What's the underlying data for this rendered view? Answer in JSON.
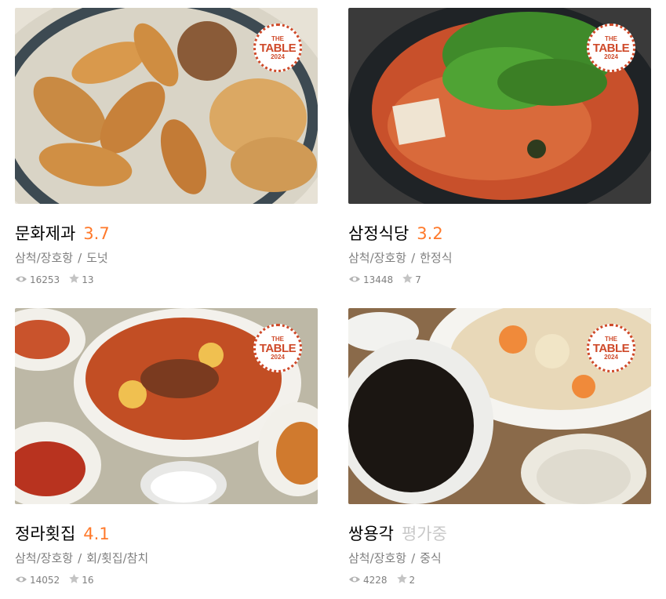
{
  "badge": {
    "line1": "THE",
    "line2": "TABLE",
    "line3": "2024"
  },
  "colors": {
    "rating": "#ff792a",
    "pending": "#c8c8c8",
    "meta": "#7f7f7f",
    "badge": "#cf4a2a"
  },
  "icons": {
    "views": "eye-icon",
    "reviews": "star-icon"
  },
  "restaurants": [
    {
      "name": "문화제과",
      "rating": "3.7",
      "area": "삼척/장호항",
      "separator": "/",
      "category": "도넛",
      "views": "16253",
      "reviews": "13",
      "image": "fried-twisted-donuts"
    },
    {
      "name": "삼정식당",
      "rating": "3.2",
      "area": "삼척/장호항",
      "separator": "/",
      "category": "한정식",
      "views": "13448",
      "reviews": "7",
      "image": "spicy-stew-with-crown-daisy"
    },
    {
      "name": "정라횟집",
      "rating": "4.1",
      "area": "삼척/장호항",
      "separator": "/",
      "category": "회/횟집/참치",
      "views": "14052",
      "reviews": "16",
      "image": "braised-fish-with-side-dishes"
    },
    {
      "name": "쌍용각",
      "rating": "평가중",
      "area": "삼척/장호항",
      "separator": "/",
      "category": "중식",
      "views": "4228",
      "reviews": "2",
      "image": "jajangmyeon-and-sweet-sour-pork"
    }
  ]
}
